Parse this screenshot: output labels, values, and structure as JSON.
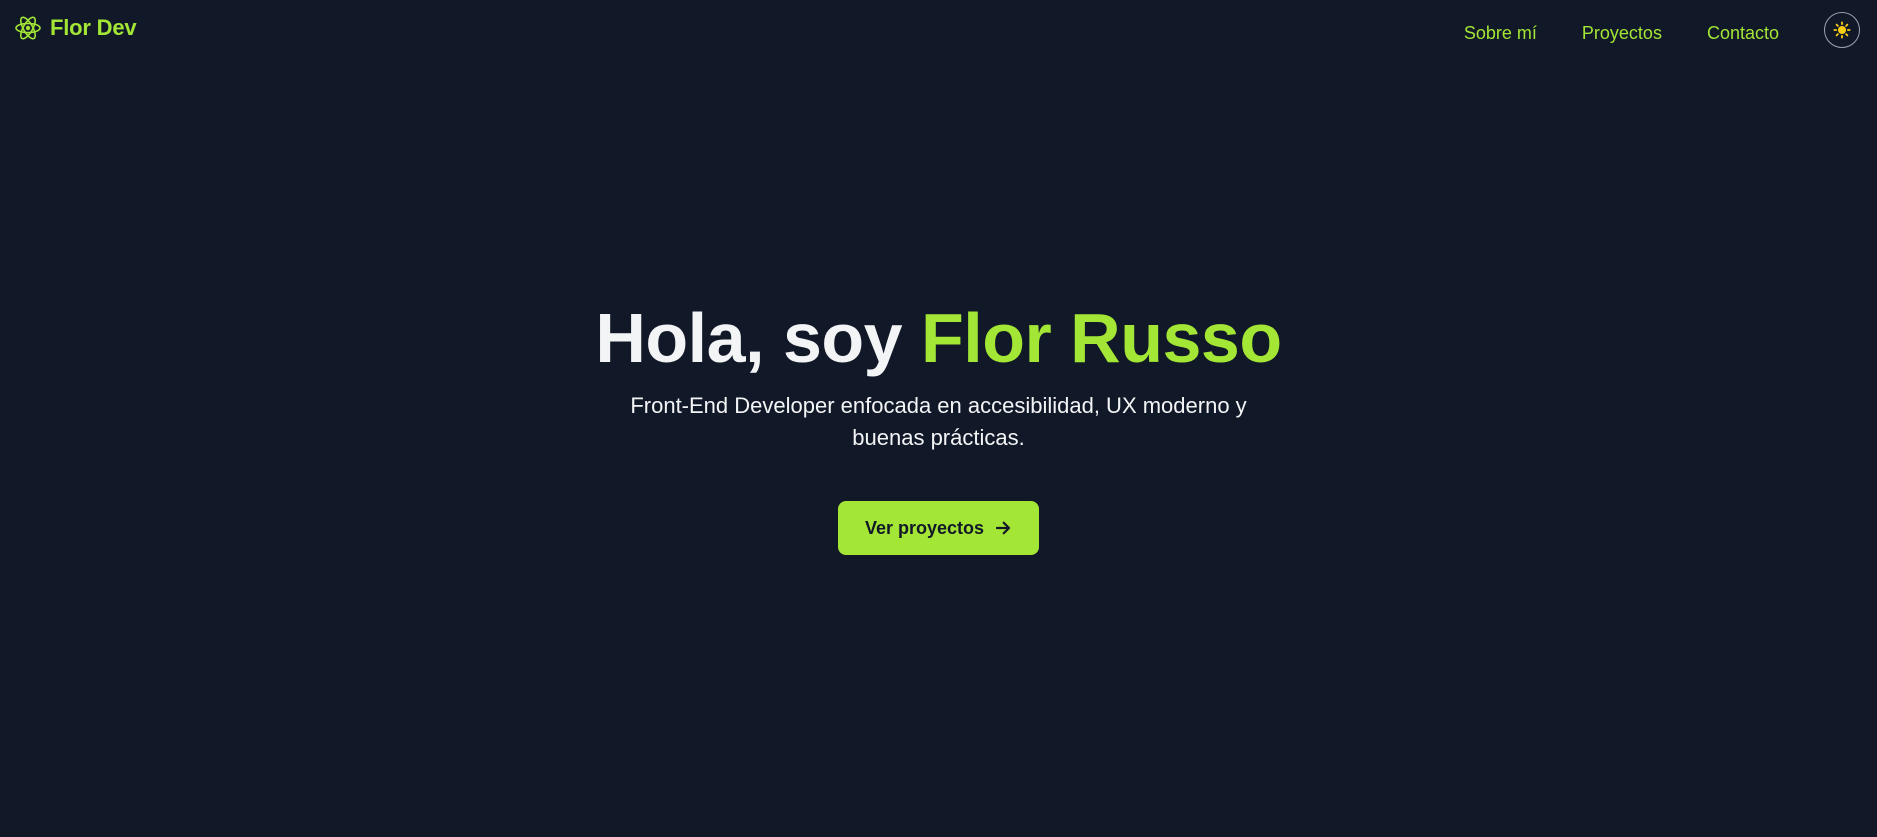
{
  "header": {
    "brand": "Flor Dev",
    "brand_icon": "atom-icon",
    "nav": [
      {
        "label": "Sobre mí"
      },
      {
        "label": "Proyectos"
      },
      {
        "label": "Contacto"
      }
    ],
    "theme_toggle_icon": "sun-icon"
  },
  "hero": {
    "title_prefix": "Hola, soy ",
    "title_name": "Flor Russo",
    "subtitle": "Front-End Developer enfocada en accesibilidad, UX moderno y buenas prácticas.",
    "cta_label": "Ver proyectos",
    "cta_icon": "arrow-right-icon"
  },
  "colors": {
    "background": "#111827",
    "accent": "#a3e635",
    "text": "#f3f4f6",
    "sun": "#facc15"
  }
}
